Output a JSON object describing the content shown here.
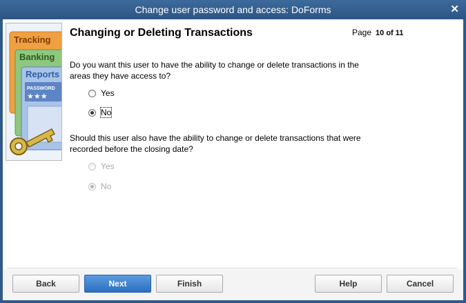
{
  "window": {
    "title": "Change user password and access: DoForms",
    "close_label": "✕"
  },
  "art": {
    "tabs": [
      "Tracking",
      "Banking",
      "Reports"
    ],
    "password_label": "PASSWORD",
    "stars": "★★★"
  },
  "heading": "Changing or Deleting Transactions",
  "page": {
    "label": "Page",
    "value": "10 of 11"
  },
  "question1": {
    "text": "Do you want this user to have the ability to change or delete transactions in the areas they have access to?",
    "options": [
      {
        "label": "Yes",
        "selected": false
      },
      {
        "label": "No",
        "selected": true
      }
    ]
  },
  "question2": {
    "text": "Should this user also have the ability to change or delete transactions that were recorded before the closing date?",
    "disabled": true,
    "options": [
      {
        "label": "Yes",
        "selected": false
      },
      {
        "label": "No",
        "selected": true
      }
    ]
  },
  "buttons": {
    "back": "Back",
    "next": "Next",
    "finish": "Finish",
    "help": "Help",
    "cancel": "Cancel"
  },
  "colors": {
    "titlebar": "#2f5a8a",
    "primary_button": "#3a80d0",
    "tab_tracking": "#f0a040",
    "tab_banking": "#8fc77f",
    "tab_reports": "#7fa3d6",
    "key": "#d8b84a"
  }
}
